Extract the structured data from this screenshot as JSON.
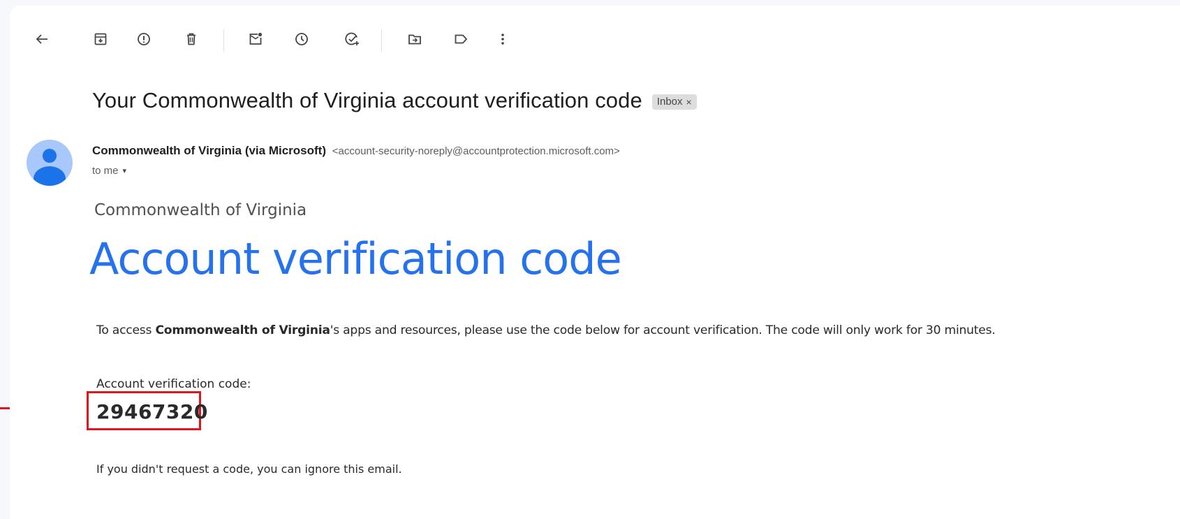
{
  "toolbar": {
    "icons": [
      "back-arrow-icon",
      "archive-icon",
      "report-spam-icon",
      "delete-icon",
      "mark-unread-icon",
      "snooze-icon",
      "add-to-tasks-icon",
      "move-to-icon",
      "label-icon",
      "more-vert-icon"
    ]
  },
  "email": {
    "subject": "Your Commonwealth of Virginia account verification code",
    "label": "Inbox",
    "label_remove": "×",
    "sender_name": "Commonwealth of Virginia (via Microsoft)",
    "sender_email": "<account-security-noreply@accountprotection.microsoft.com>",
    "recipient": "to me",
    "recipient_caret": "▾"
  },
  "message": {
    "org_name": "Commonwealth of Virginia",
    "headline": "Account verification code",
    "intro_prefix": "To access ",
    "intro_bold": "Commonwealth of Virginia",
    "intro_suffix": "'s apps and resources, please use the code below for account verification. The code will only work for 30 minutes.",
    "code_label": "Account verification code:",
    "code": "29467320",
    "ignore_text": "If you didn't request a code, you can ignore this email."
  },
  "colors": {
    "accent_blue": "#2672ec",
    "highlight_red": "#e2141c",
    "avatar_bg": "#a8c7fa",
    "avatar_fg": "#1a73e8"
  }
}
